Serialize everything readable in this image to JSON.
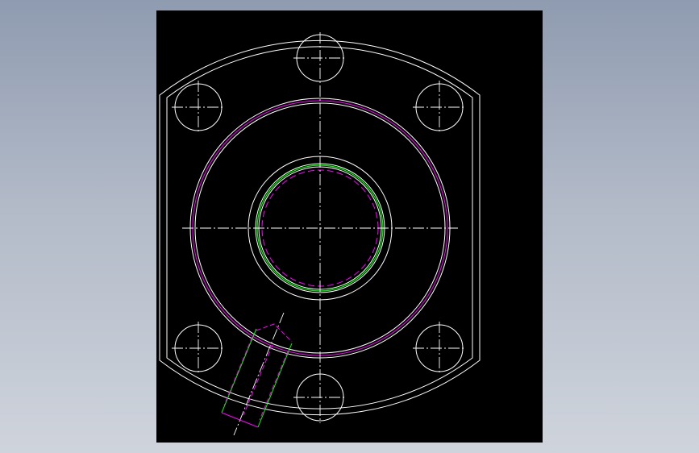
{
  "viewport": {
    "background_top": "#8f9bb0",
    "background_bottom": "#cfd4dc",
    "sheet_color": "#000000"
  },
  "drawing": {
    "view": "flange-front-view",
    "line_colors": {
      "outline": "#ffffff",
      "center_line": "#ffffff",
      "hidden_line": "#ff00ff",
      "thread_line": "#00ff00"
    },
    "bolt_hole_count": 6,
    "features": [
      "flange-outline",
      "bolt-holes",
      "bore",
      "thread",
      "cross-port"
    ]
  }
}
